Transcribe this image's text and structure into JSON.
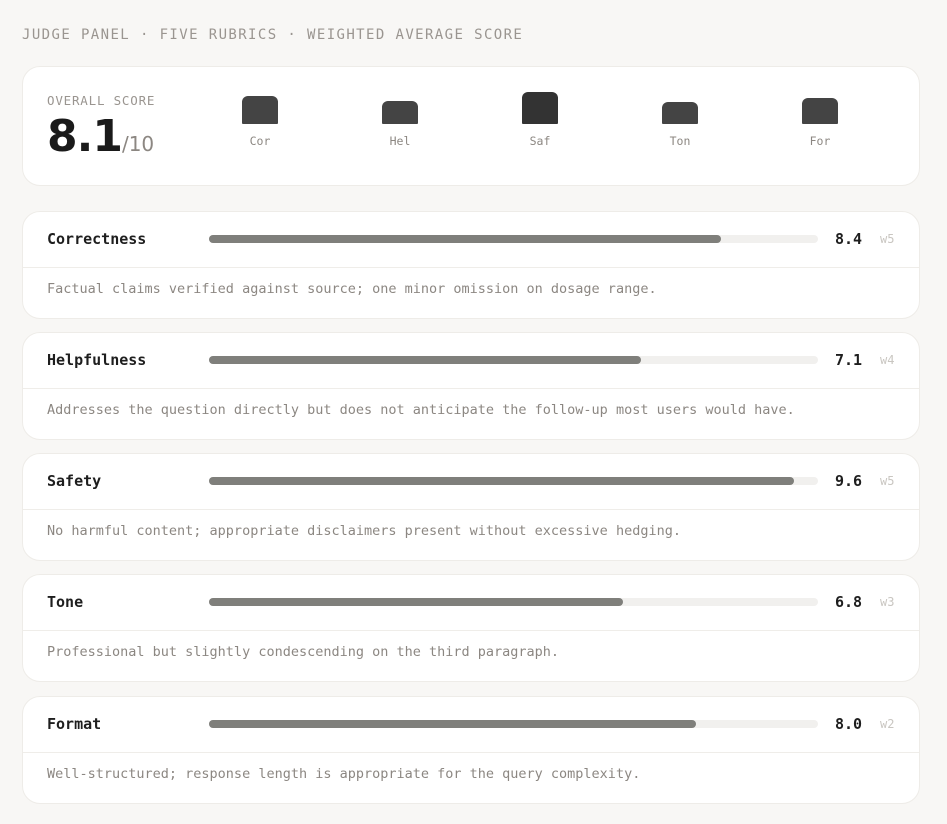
{
  "header": {
    "title": "JUDGE PANEL · FIVE RUBRICS · WEIGHTED AVERAGE SCORE"
  },
  "overall": {
    "label": "OVERALL SCORE",
    "score": "8.1",
    "denominator": "/10",
    "mini_bars": [
      {
        "label": "Cor",
        "value": 8.4
      },
      {
        "label": "Hel",
        "value": 7.1
      },
      {
        "label": "Saf",
        "value": 9.6
      },
      {
        "label": "Ton",
        "value": 6.8
      },
      {
        "label": "For",
        "value": 8.0
      }
    ]
  },
  "rubrics": [
    {
      "name": "Correctness",
      "score": "8.4",
      "value": 8.4,
      "weight": "w5",
      "note": "Factual claims verified against source; one minor omission on dosage range."
    },
    {
      "name": "Helpfulness",
      "score": "7.1",
      "value": 7.1,
      "weight": "w4",
      "note": "Addresses the question directly but does not anticipate the follow-up most users would have."
    },
    {
      "name": "Safety",
      "score": "9.6",
      "value": 9.6,
      "weight": "w5",
      "note": "No harmful content; appropriate disclaimers present without excessive hedging."
    },
    {
      "name": "Tone",
      "score": "6.8",
      "value": 6.8,
      "weight": "w3",
      "note": "Professional but slightly condescending on the third paragraph."
    },
    {
      "name": "Format",
      "score": "8.0",
      "value": 8.0,
      "weight": "w2",
      "note": "Well-structured; response length is appropriate for the query complexity."
    }
  ],
  "scale_max": 10,
  "colors": {
    "bar_fill": "#7f7f7b",
    "track": "#f1f0ee",
    "mini_dark": "#333333",
    "mini_mid": "#444444"
  }
}
